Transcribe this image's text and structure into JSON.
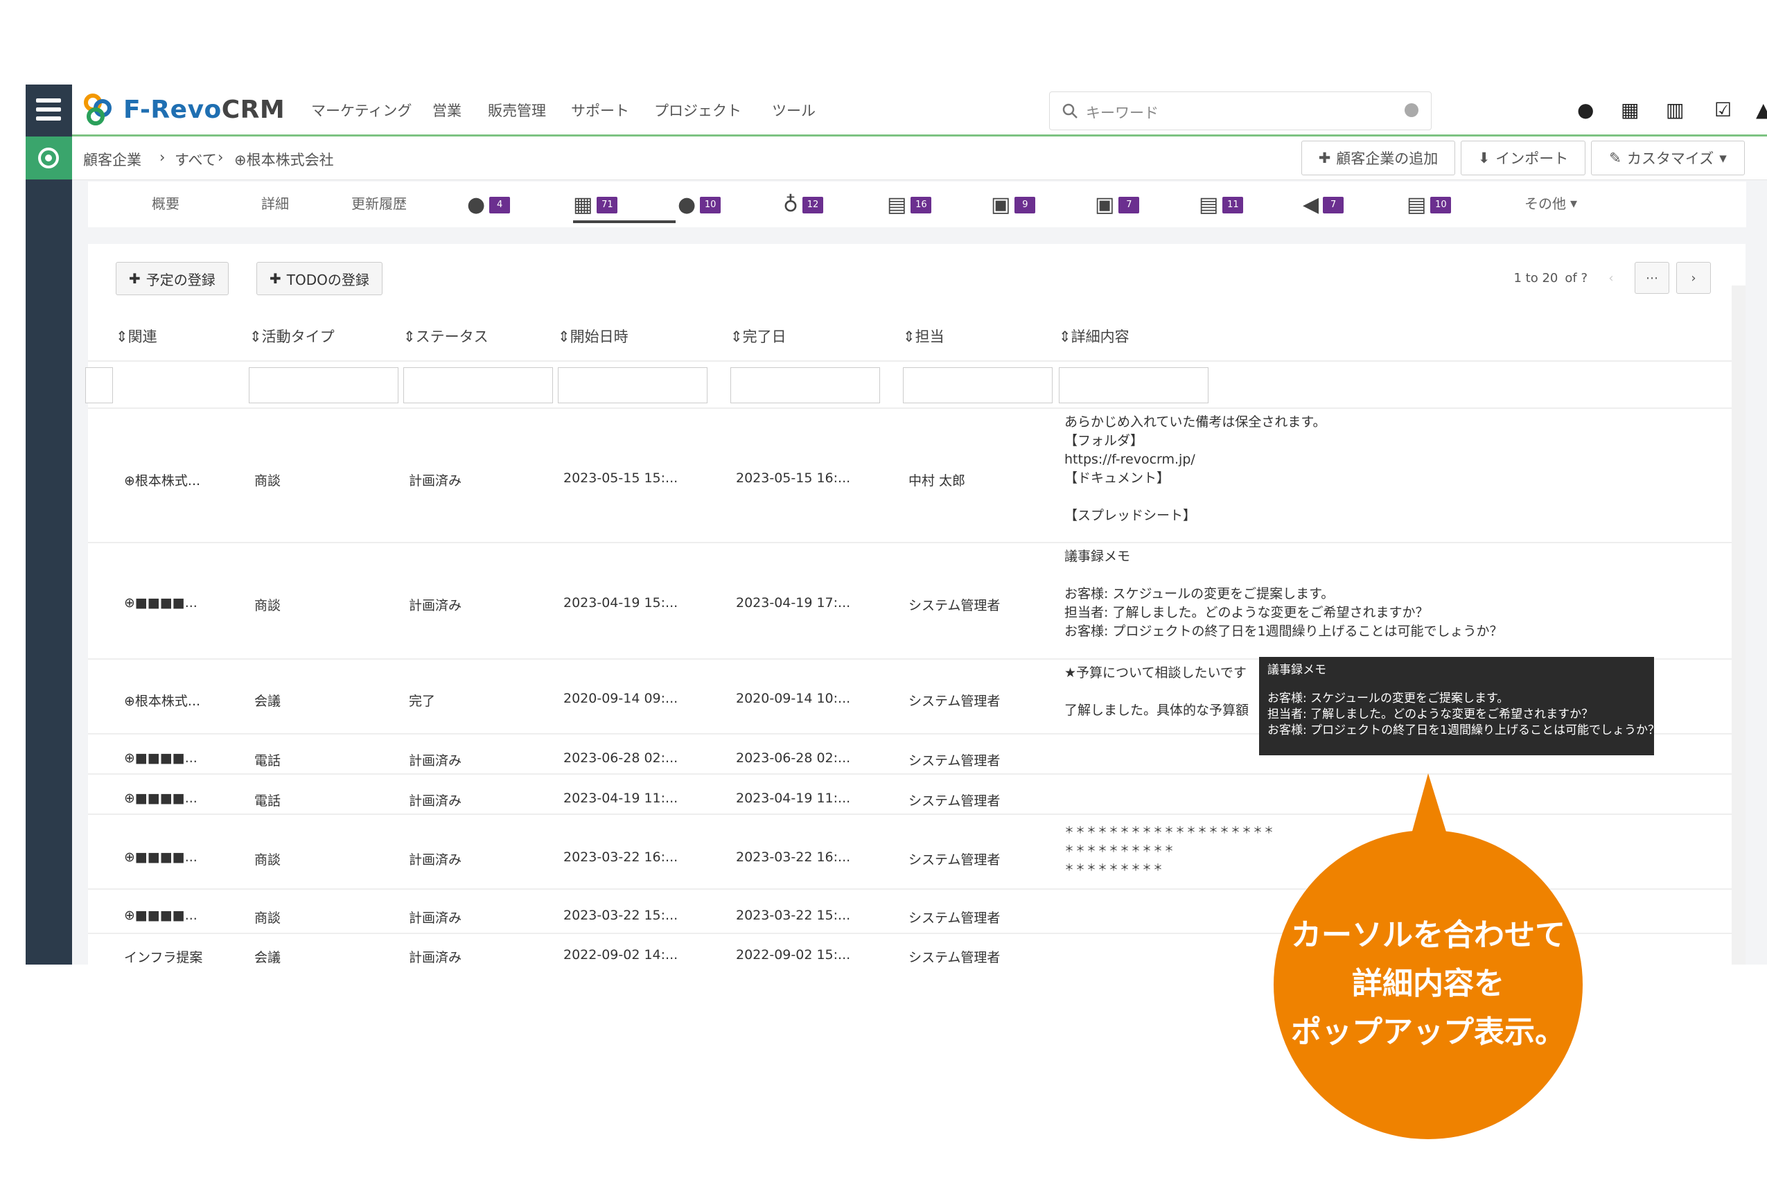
{
  "app": {
    "logo_prefix": "F-Revo",
    "logo_suffix": "CRM",
    "menu": [
      "マーケティング",
      "営業",
      "販売管理",
      "サポート",
      "プロジェクト",
      "ツール"
    ],
    "search_placeholder": "キーワード"
  },
  "breadcrumb": {
    "items": [
      "顧客企業",
      "›",
      "すべて",
      "›",
      "⊕根本株式会社"
    ]
  },
  "header_buttons": {
    "add": "顧客企業の追加",
    "import": "インポート",
    "customize": "カスタマイズ"
  },
  "tabs": [
    {
      "label": "概要",
      "badge": ""
    },
    {
      "label": "詳細",
      "badge": ""
    },
    {
      "label": "更新履歴",
      "badge": ""
    },
    {
      "icon": "comment-icon",
      "badge": "4"
    },
    {
      "icon": "calendar-icon",
      "badge": "71"
    },
    {
      "icon": "contact-icon",
      "badge": "10"
    },
    {
      "icon": "money-bag-icon",
      "badge": "12"
    },
    {
      "icon": "ticket-icon",
      "badge": "16"
    },
    {
      "icon": "quote-icon",
      "badge": "9"
    },
    {
      "icon": "sales-order-icon",
      "badge": "7"
    },
    {
      "icon": "invoice-icon",
      "badge": "11"
    },
    {
      "icon": "campaign-icon",
      "badge": "7"
    },
    {
      "icon": "document-icon",
      "badge": "10"
    },
    {
      "label": "その他",
      "badge": ""
    }
  ],
  "actions": {
    "add_event": "予定の登録",
    "add_todo": "TODOの登録"
  },
  "pager": {
    "range": "1 to 20",
    "of": "of ?"
  },
  "columns": [
    "関連",
    "活動タイプ",
    "ステータス",
    "開始日時",
    "完了日",
    "担当",
    "詳細内容"
  ],
  "rows": [
    {
      "related": "⊕根本株式...",
      "type": "商談",
      "status": "計画済み",
      "start": "2023-05-15 15:...",
      "end": "2023-05-15 16:...",
      "owner": "中村 太郎",
      "detail": [
        "あらかじめ入れていた備考は保全されます。",
        "【フォルダ】",
        "https://f-revocrm.jp/",
        "【ドキュメント】",
        "",
        "【スプレッドシート】"
      ]
    },
    {
      "related": "⊕■■■■...",
      "type": "商談",
      "status": "計画済み",
      "start": "2023-04-19 15:...",
      "end": "2023-04-19 17:...",
      "owner": "システム管理者",
      "detail": [
        "議事録メモ",
        "",
        "お客様: スケジュールの変更をご提案します。",
        "担当者: 了解しました。どのような変更をご希望されますか？",
        "お客様: プロジェクトの終了日を1週間繰り上げることは可能でしょうか？"
      ]
    },
    {
      "related": "⊕根本株式...",
      "type": "会議",
      "status": "完了",
      "start": "2020-09-14 09:...",
      "end": "2020-09-14 10:...",
      "owner": "システム管理者",
      "detail": [
        "★予算について相談したいです",
        "",
        "了解しました。具体的な予算額"
      ]
    },
    {
      "related": "⊕■■■■...",
      "type": "電話",
      "status": "計画済み",
      "start": "2023-06-28 02:...",
      "end": "2023-06-28 02:...",
      "owner": "システム管理者",
      "detail": []
    },
    {
      "related": "⊕■■■■...",
      "type": "電話",
      "status": "計画済み",
      "start": "2023-04-19 11:...",
      "end": "2023-04-19 11:...",
      "owner": "システム管理者",
      "detail": []
    },
    {
      "related": "⊕■■■■...",
      "type": "商談",
      "status": "計画済み",
      "start": "2023-03-22 16:...",
      "end": "2023-03-22 16:...",
      "owner": "システム管理者",
      "detail": [
        "＊＊＊＊＊＊＊＊＊＊＊＊＊＊＊＊＊＊＊",
        "＊＊＊＊＊＊＊＊＊＊",
        "＊＊＊＊＊＊＊＊＊"
      ]
    },
    {
      "related": "⊕■■■■...",
      "type": "商談",
      "status": "計画済み",
      "start": "2023-03-22 15:...",
      "end": "2023-03-22 15:...",
      "owner": "システム管理者",
      "detail": []
    },
    {
      "related": "インフラ提案",
      "type": "会議",
      "status": "計画済み",
      "start": "2022-09-02 14:...",
      "end": "2022-09-02 15:...",
      "owner": "システム管理者",
      "detail": []
    }
  ],
  "tooltip": {
    "lines": [
      "議事録メモ",
      "",
      "お客様: スケジュールの変更をご提案します。",
      "担当者: 了解しました。どのような変更をご希望されますか？",
      "お客様: プロジェクトの終了日を1週間繰り上げることは可能でしょうか？"
    ]
  },
  "callout": {
    "lines": [
      "カーソルを合わせて",
      "詳細内容を",
      "ポップアップ表示。"
    ],
    "color": "#ef8200"
  },
  "colors": {
    "sidebar": "#2c3b4b",
    "badge": "#6b2f8f",
    "green": "#3aa56c"
  }
}
